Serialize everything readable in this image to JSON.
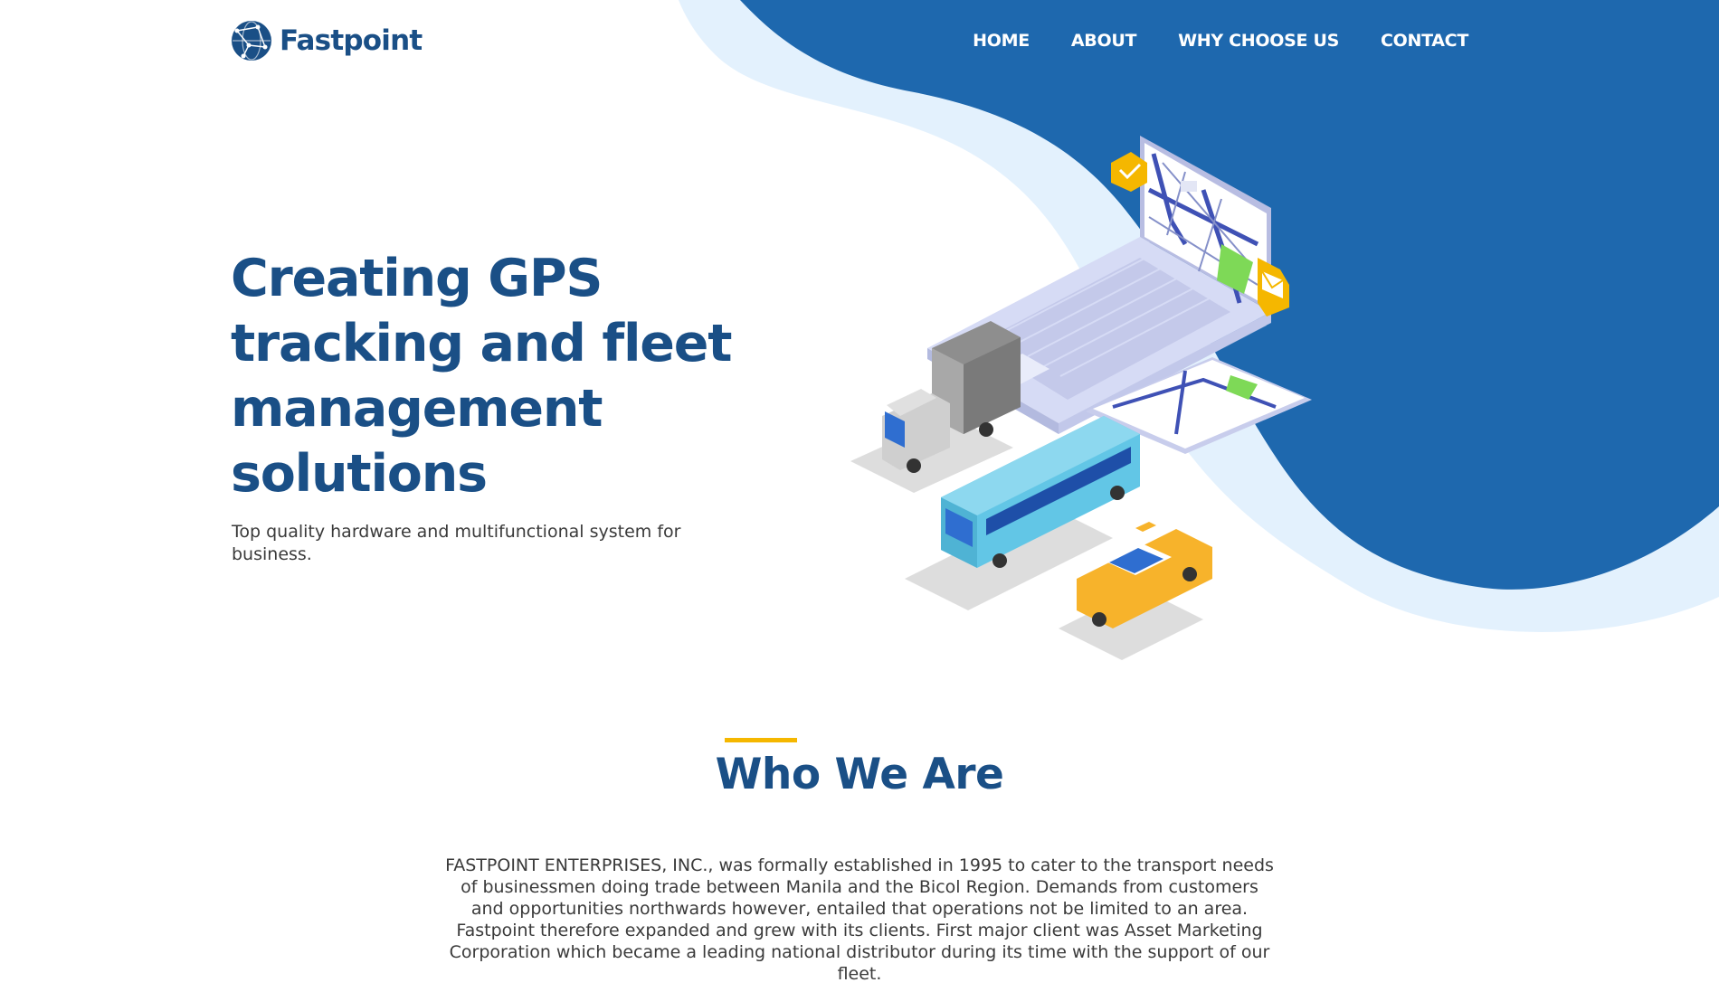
{
  "brand": {
    "name": "Fastpoint",
    "logo_icon": "globe-network-icon"
  },
  "nav": {
    "items": [
      {
        "label": "HOME"
      },
      {
        "label": "ABOUT"
      },
      {
        "label": "WHY CHOOSE US"
      },
      {
        "label": "CONTACT"
      }
    ]
  },
  "hero": {
    "title": "Creating GPS tracking and fleet management solutions",
    "subtitle": "Top quality hardware and multifunctional system for business.",
    "illustration": "fleet-tracking-illustration"
  },
  "who_we_are": {
    "title": "Who We Are",
    "body": "FASTPOINT ENTERPRISES, INC., was formally established in 1995 to cater to the transport needs of businessmen doing trade between Manila and the Bicol Region. Demands from customers and opportunities northwards however, entailed that operations not be limited to an area. Fastpoint therefore expanded and grew with its clients. First major client was Asset Marketing Corporation which became a leading national distributor during its time with the support of our fleet."
  },
  "colors": {
    "primary_blue": "#1e68ae",
    "heading_blue": "#1a4f86",
    "light_blue": "#e3f1fd",
    "accent_yellow": "#f5b700",
    "body_text": "#3a3a3a"
  }
}
